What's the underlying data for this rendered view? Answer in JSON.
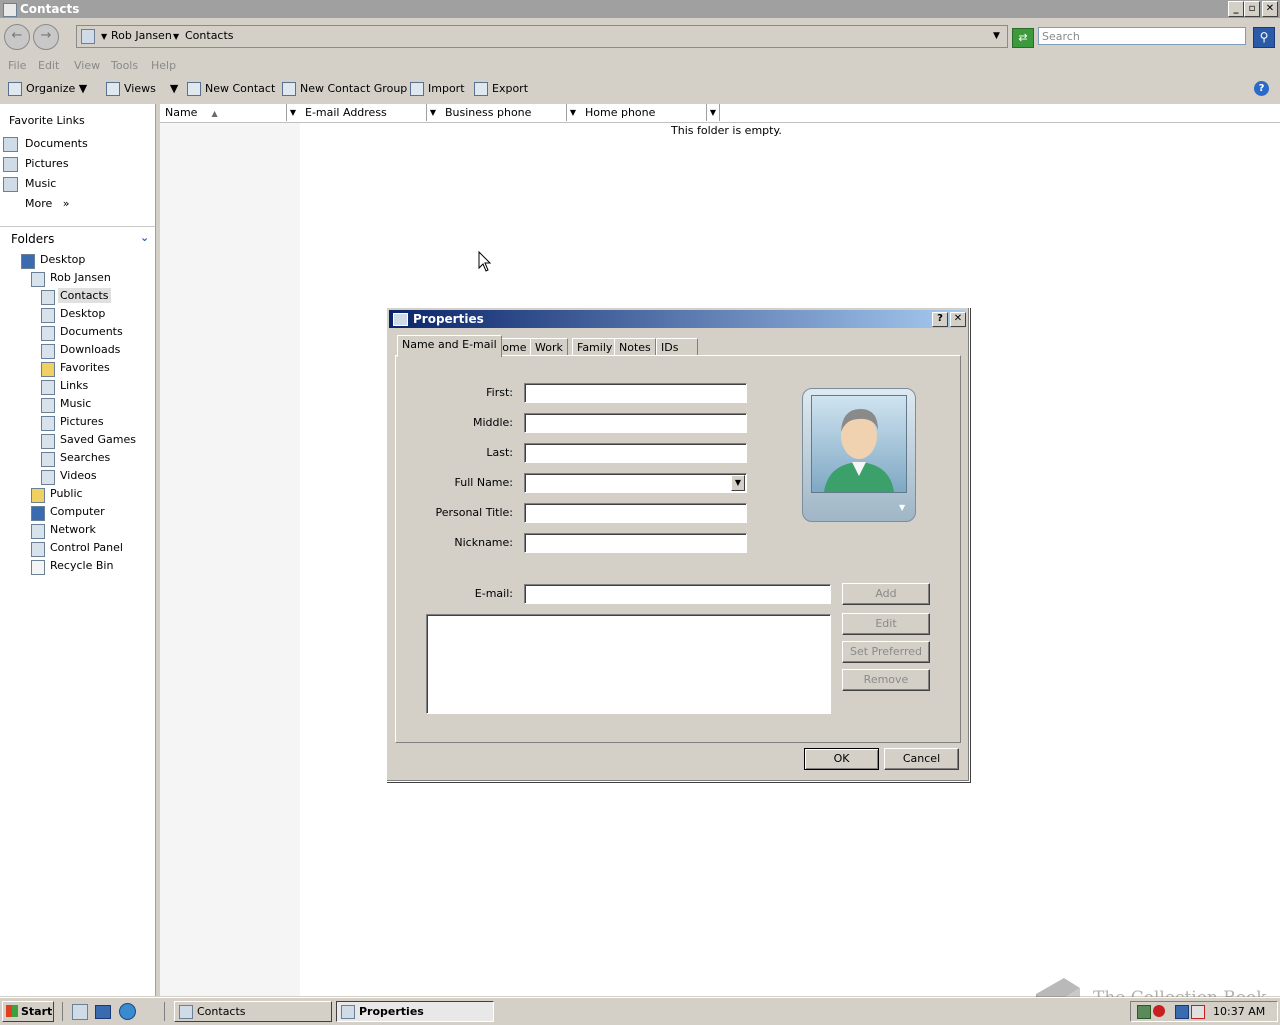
{
  "window": {
    "title": "Contacts"
  },
  "address": {
    "crumbs": [
      "Rob Jansen",
      "Contacts"
    ]
  },
  "search": {
    "placeholder": "Search"
  },
  "menu": [
    "File",
    "Edit",
    "View",
    "Tools",
    "Help"
  ],
  "toolbar": {
    "organize": "Organize",
    "views": "Views",
    "new_contact": "New Contact",
    "new_group": "New Contact Group",
    "import": "Import",
    "export": "Export"
  },
  "favorites": {
    "header": "Favorite Links",
    "items": [
      "Documents",
      "Pictures",
      "Music"
    ],
    "more": "More"
  },
  "folders": {
    "header": "Folders",
    "items": [
      "Desktop",
      "Rob Jansen",
      "Contacts",
      "Desktop",
      "Documents",
      "Downloads",
      "Favorites",
      "Links",
      "Music",
      "Pictures",
      "Saved Games",
      "Searches",
      "Videos",
      "Public",
      "Computer",
      "Network",
      "Control Panel",
      "Recycle Bin"
    ]
  },
  "columns": [
    "Name",
    "E-mail Address",
    "Business phone",
    "Home phone"
  ],
  "empty_message": "This folder is empty.",
  "dialog": {
    "title": "Properties",
    "tabs": [
      "Name and E-mail",
      "Home",
      "Work",
      "Family",
      "Notes",
      "IDs"
    ],
    "labels": {
      "first": "First:",
      "middle": "Middle:",
      "last": "Last:",
      "full_name": "Full Name:",
      "personal_title": "Personal Title:",
      "nickname": "Nickname:",
      "email": "E-mail:"
    },
    "buttons": {
      "add": "Add",
      "edit": "Edit",
      "set_preferred": "Set Preferred",
      "remove": "Remove",
      "ok": "OK",
      "cancel": "Cancel"
    }
  },
  "taskbar": {
    "start": "Start",
    "tasks": [
      "Contacts",
      "Properties"
    ],
    "clock": "10:37 AM"
  },
  "watermark": "The Collection Book"
}
